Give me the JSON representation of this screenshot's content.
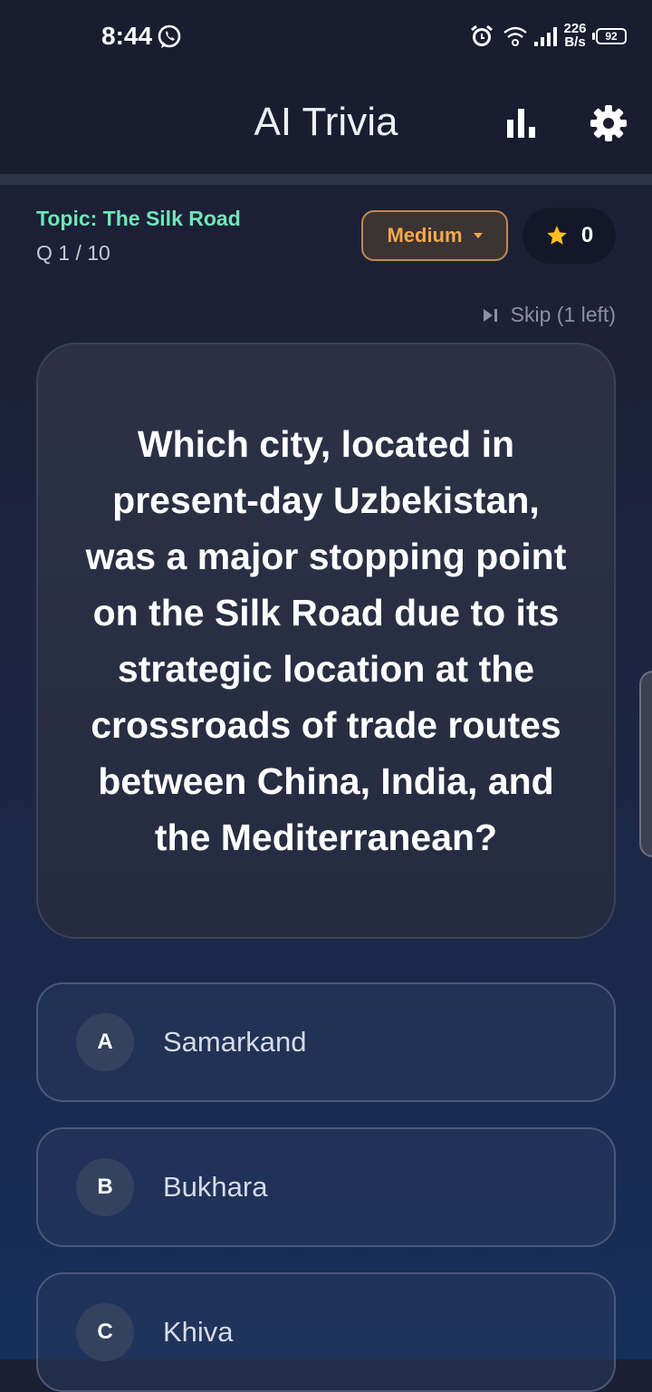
{
  "status_bar": {
    "time": "8:44",
    "net_speed_value": "226",
    "net_speed_unit": "B/s",
    "battery": "92"
  },
  "app_bar": {
    "title": "AI Trivia",
    "stats_icon": "bar-chart-icon",
    "settings_icon": "gear-icon"
  },
  "quiz": {
    "topic": "Topic: The Silk Road",
    "progress": "Q 1 / 10",
    "difficulty": "Medium",
    "score": "0",
    "skip_label": "Skip (1 left)",
    "question": "Which city, located in present-day Uzbekistan, was a major stopping point on the Silk Road due to its strategic location at the crossroads of trade routes between China, India, and the Mediterranean?",
    "answers": [
      {
        "letter": "A",
        "text": "Samarkand"
      },
      {
        "letter": "B",
        "text": "Bukhara"
      },
      {
        "letter": "C",
        "text": "Khiva"
      }
    ]
  },
  "colors": {
    "topic": "#6ee7b7",
    "difficulty": "#f5a94c",
    "star": "#fbbf24"
  }
}
